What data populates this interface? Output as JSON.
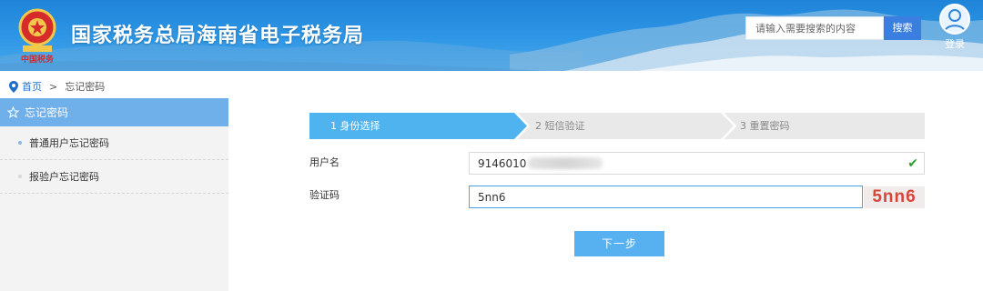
{
  "header": {
    "title": "国家税务总局海南省电子税务局",
    "search": {
      "placeholder": "请输入需要搜索的内容",
      "button_label": "搜索"
    },
    "login_label": "登录",
    "emblem_text": "中国税务"
  },
  "breadcrumb": {
    "home": "首页",
    "separator": ">",
    "current": "忘记密码"
  },
  "sidebar": {
    "header": "忘记密码",
    "items": [
      {
        "label": "普通用户忘记密码"
      },
      {
        "label": "报验户忘记密码"
      }
    ]
  },
  "steps": [
    {
      "label": "1  身份选择",
      "state": "active"
    },
    {
      "label": "2  短信验证",
      "state": "inactive"
    },
    {
      "label": "3  重置密码",
      "state": "inactive"
    }
  ],
  "form": {
    "username_label": "用户名",
    "username_value": "9146010",
    "captcha_label": "验证码",
    "captcha_value": "5nn6",
    "captcha_image_text": "5nn6",
    "next_label": "下一步"
  },
  "colors": {
    "header_blue": "#2f97e6",
    "step_active": "#4fb3f0",
    "step_inactive": "#e9e9e9",
    "sidebar_active": "#6fb0ea",
    "button": "#57b1f1",
    "captcha_text": "#d8453a"
  }
}
